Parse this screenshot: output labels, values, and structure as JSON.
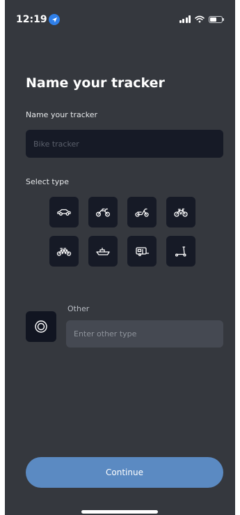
{
  "status_bar": {
    "time": "12:19",
    "location_icon": "location-arrow-icon",
    "signal_icon": "cellular-signal-icon",
    "wifi_icon": "wifi-icon",
    "battery_icon": "battery-icon"
  },
  "page": {
    "title": "Name your tracker"
  },
  "name_field": {
    "label": "Name your tracker",
    "placeholder": "Bike tracker",
    "value": ""
  },
  "type_section": {
    "label": "Select type",
    "types": [
      {
        "icon": "car-icon"
      },
      {
        "icon": "motorcycle-icon"
      },
      {
        "icon": "scooter-moped-icon"
      },
      {
        "icon": "bicycle-icon"
      },
      {
        "icon": "tandem-bicycle-icon"
      },
      {
        "icon": "boat-icon"
      },
      {
        "icon": "caravan-icon"
      },
      {
        "icon": "kick-scooter-icon"
      }
    ]
  },
  "other": {
    "icon": "target-circle-icon",
    "label": "Other",
    "placeholder": "Enter other type",
    "value": ""
  },
  "continue_button": {
    "label": "Continue"
  },
  "colors": {
    "background": "#35383e",
    "tile": "#161a26",
    "accent": "#5b8ac2",
    "location_badge": "#2f7fe8"
  }
}
